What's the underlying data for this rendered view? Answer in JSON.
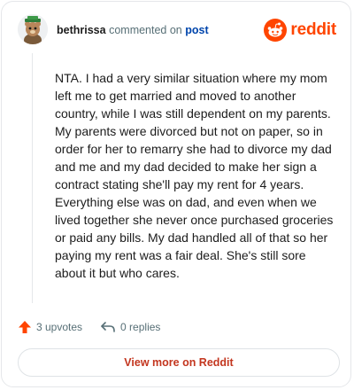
{
  "header": {
    "username": "bethrissa",
    "commented_text": "commented on",
    "post_link": "post",
    "brand": "reddit"
  },
  "comment": {
    "text": "NTA. I had a very similar situation where my mom left me to get married and moved to another country, while I was still dependent on my parents. My parents were divorced but not on paper, so in order for her to remarry she had to divorce my dad and me and my dad decided to make her sign a contract stating she'll pay my rent for 4 years. Everything else was on dad, and even when we lived together she never once purchased groceries or paid any bills. My dad handled all of that so her paying my rent was a fair deal. She's still sore about it but who cares."
  },
  "actions": {
    "upvotes": "3 upvotes",
    "replies": "0 replies"
  },
  "footer": {
    "view_more": "View more on Reddit"
  },
  "colors": {
    "brand": "#ff4500",
    "link": "#0045ac",
    "view_more": "#c3361f"
  },
  "icons": {
    "avatar": "avatar-bear",
    "brand": "reddit-snoo-icon",
    "upvote": "arrow-up-icon",
    "reply": "reply-arrow-icon"
  }
}
